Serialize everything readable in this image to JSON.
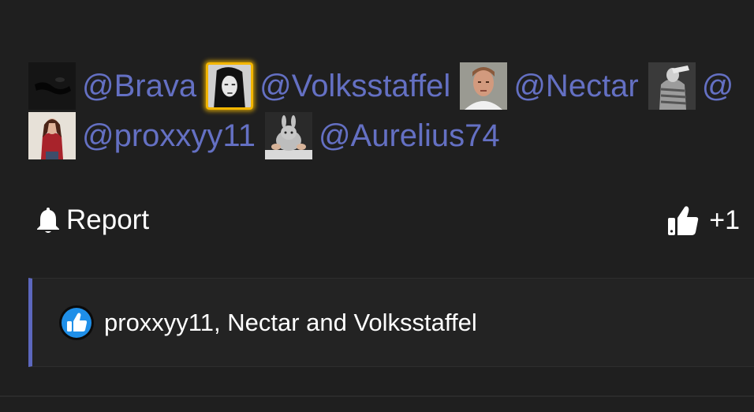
{
  "mentions": [
    {
      "username": "@Brava",
      "avatar_icon": "avatar-brava-icon",
      "highlighted": false
    },
    {
      "username": "@Volksstaffel",
      "avatar_icon": "avatar-volksstaffel-icon",
      "highlighted": true
    },
    {
      "username": "@Nectar",
      "avatar_icon": "avatar-nectar-icon",
      "highlighted": false
    },
    {
      "username": "@",
      "avatar_icon": "avatar-truncated-user-icon",
      "highlighted": false
    },
    {
      "username": "@proxxyy11",
      "avatar_icon": "avatar-proxxyy11-icon",
      "highlighted": false
    },
    {
      "username": "@Aurelius74",
      "avatar_icon": "avatar-aurelius74-icon",
      "highlighted": false
    }
  ],
  "actions": {
    "report_label": "Report",
    "report_icon": "bell-icon",
    "like_count": "+1",
    "like_icon": "thumbs-up-icon"
  },
  "likes": {
    "badge_icon": "like-badge-icon",
    "likers_text": "proxxyy11, Nectar and Volksstaffel"
  },
  "colors": {
    "background": "#1f1f1f",
    "username": "#6470c3",
    "accent_border": "#5c67be",
    "highlight": "#f3b600",
    "like_badge": "#1f8fe8"
  }
}
